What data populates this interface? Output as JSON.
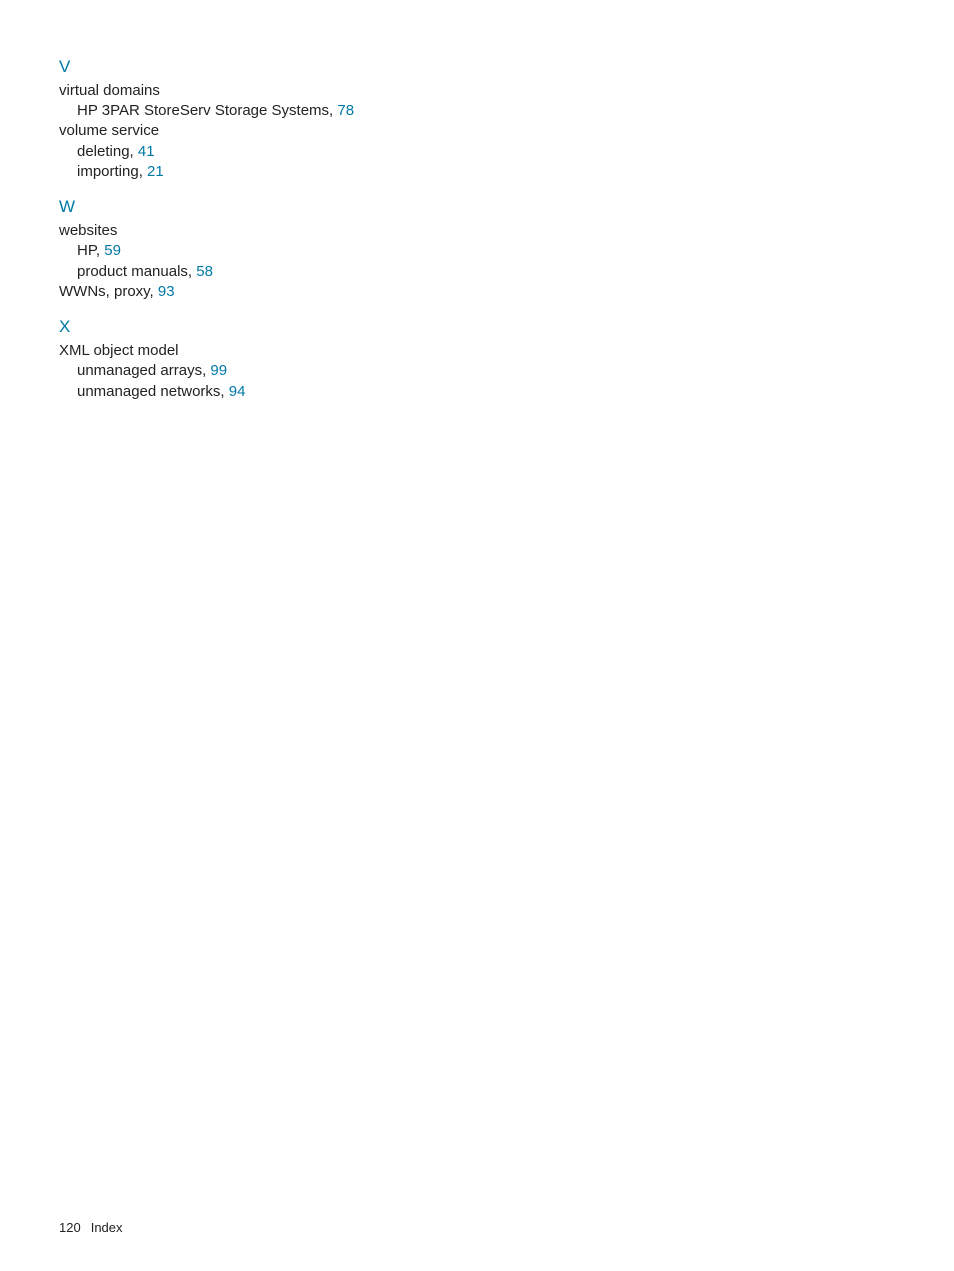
{
  "footer": {
    "page_number": "120",
    "section": "Index"
  },
  "sections": {
    "v": {
      "letter": "V",
      "e1_label": "virtual domains",
      "e1_sub1_text": "HP 3PAR StoreServ Storage Systems, ",
      "e1_sub1_page": "78",
      "e2_label": "volume service",
      "e2_sub1_text": "deleting, ",
      "e2_sub1_page": "41",
      "e2_sub2_text": "importing, ",
      "e2_sub2_page": "21"
    },
    "w": {
      "letter": "W",
      "e1_label": "websites",
      "e1_sub1_text": "HP, ",
      "e1_sub1_page": "59",
      "e1_sub2_text": "product manuals, ",
      "e1_sub2_page": "58",
      "e2_text": "WWNs, proxy, ",
      "e2_page": "93"
    },
    "x": {
      "letter": "X",
      "e1_label": "XML object model",
      "e1_sub1_text": "unmanaged arrays, ",
      "e1_sub1_page": "99",
      "e1_sub2_text": "unmanaged networks, ",
      "e1_sub2_page": "94"
    }
  }
}
